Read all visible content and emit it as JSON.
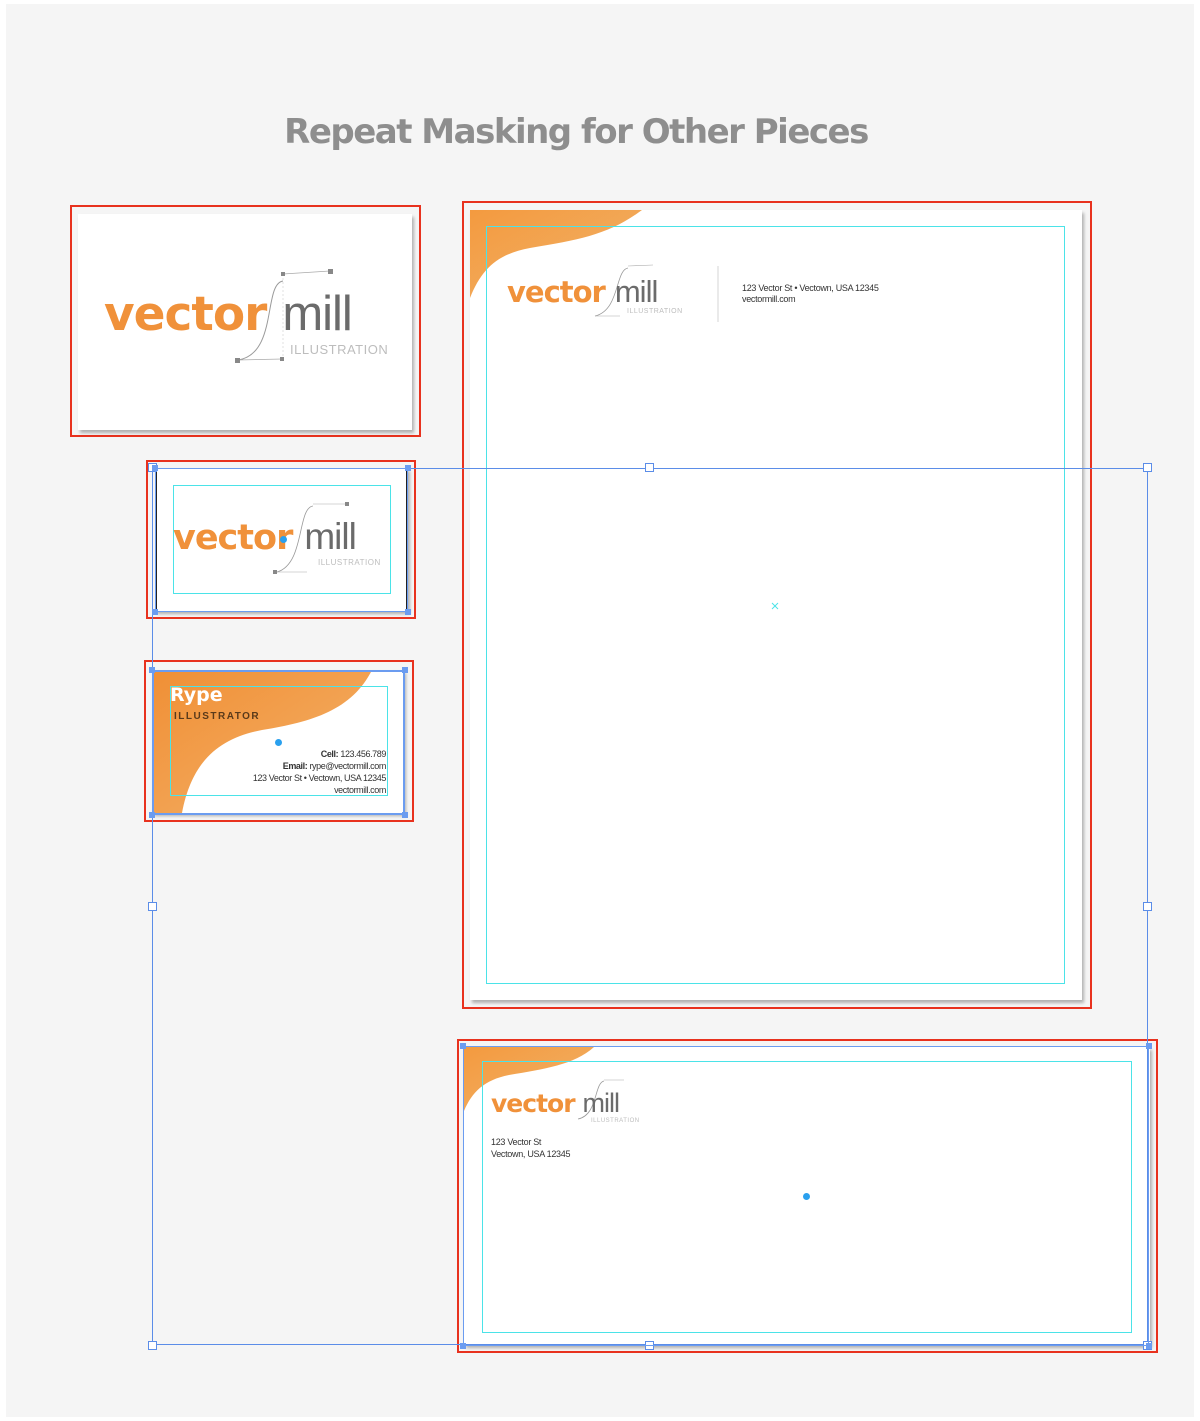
{
  "title": "Repeat Masking for Other Pieces",
  "brand": {
    "word1": "vector",
    "word2": "mill",
    "tagline": "ILLUSTRATION"
  },
  "letterhead": {
    "address_line": "123 Vector St • Vectown, USA 12345",
    "website": "vectormill.com"
  },
  "business_card_back": {
    "name": "Rype",
    "role": "ILLUSTRATOR",
    "cell_label": "Cell:",
    "cell_value": "123.456.789",
    "email_label": "Email:",
    "email_value": "rype@vectormill.com",
    "address": "123 Vector St • Vectown, USA 12345",
    "website": "vectormill.com"
  },
  "envelope": {
    "address_line1": "123 Vector St",
    "address_line2": "Vectown, USA 12345"
  },
  "colors": {
    "brand_orange": "#f0913a",
    "highlight_red": "#e8321e",
    "guide_cyan": "#4be3e8",
    "selection_blue": "#5b8de8"
  },
  "icons": [
    "center-point-icon",
    "selection-handle-icon"
  ]
}
